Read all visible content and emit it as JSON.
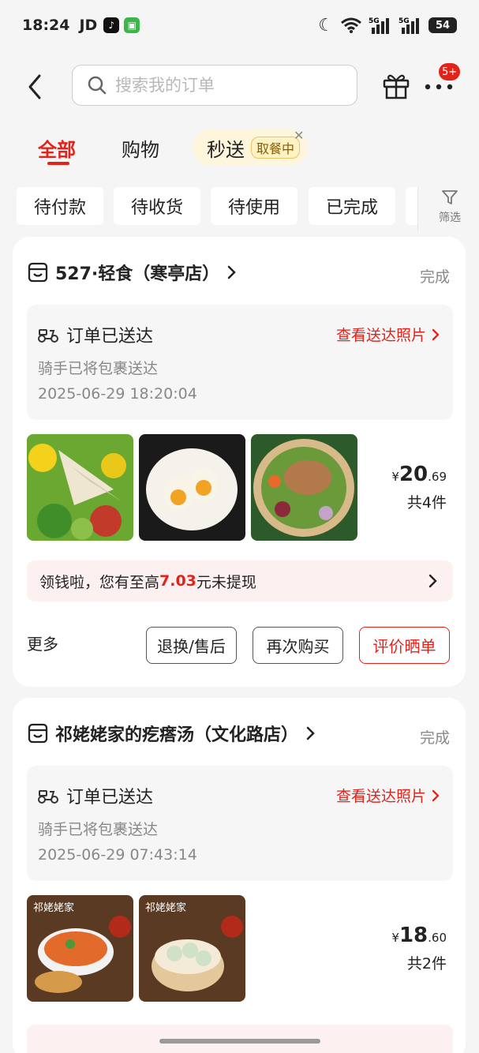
{
  "status_bar": {
    "time": "18:24",
    "carrier": "JD",
    "battery": "54"
  },
  "header": {
    "search_placeholder": "搜索我的订单",
    "badge": "5+"
  },
  "tabs": [
    {
      "label": "全部"
    },
    {
      "label": "购物"
    },
    {
      "label": "秒送",
      "sub": "取餐中"
    }
  ],
  "filters": [
    "待付款",
    "待收货",
    "待使用",
    "已完成"
  ],
  "filter_button": "筛选",
  "orders": [
    {
      "store": "527·轻食（寒亭店）",
      "status": "完成",
      "delivery_title": "订单已送达",
      "photo_link": "查看送达照片",
      "delivery_desc": "骑手已将包裹送达",
      "time": "2025-06-29 18:20:04",
      "currency": "¥",
      "price_int": "20",
      "price_dec": ".69",
      "count": "共4件",
      "promo_prefix": "领钱啦，您有至高",
      "promo_amount": "7.03",
      "promo_suffix": "元未提现",
      "more": "更多",
      "buttons": [
        "退换/售后",
        "再次购买",
        "评价晒单"
      ]
    },
    {
      "store": "祁姥姥家的疙瘩汤（文化路店）",
      "status": "完成",
      "delivery_title": "订单已送达",
      "photo_link": "查看送达照片",
      "delivery_desc": "骑手已将包裹送达",
      "time": "2025-06-29 07:43:14",
      "currency": "¥",
      "price_int": "18",
      "price_dec": ".60",
      "count": "共2件",
      "thumb_brand": "祁姥姥家"
    }
  ],
  "colors": {
    "accent": "#e2231a",
    "pill_bg": "#fdf5dc"
  }
}
